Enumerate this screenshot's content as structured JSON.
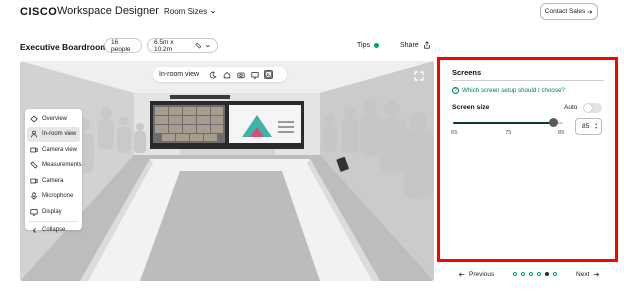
{
  "nav": {
    "logo": "CISCO",
    "app_title": "Workspace Designer",
    "room_sizes_label": "Room Sizes",
    "contact_label": "Contact Sales"
  },
  "room": {
    "name": "Executive Boardroom",
    "people": "16 people",
    "dimensions": "6.5m x 10.2m",
    "tips_label": "Tips",
    "share_label": "Share"
  },
  "viewport": {
    "toolbar_label": "In-room view",
    "toolbar_icons": [
      "moon-icon",
      "home-icon",
      "camera-icon",
      "screen-icon",
      "gallery-icon"
    ],
    "menu": [
      {
        "label": "Overview",
        "icon": "overview-icon"
      },
      {
        "label": "In-room view",
        "icon": "person-icon",
        "active": true
      },
      {
        "label": "Camera view",
        "icon": "camera-icon"
      },
      {
        "label": "Measurements",
        "icon": "ruler-icon"
      },
      {
        "label": "Camera",
        "icon": "camera-icon"
      },
      {
        "label": "Microphone",
        "icon": "microphone-icon"
      },
      {
        "label": "Display",
        "icon": "display-icon"
      },
      {
        "label": "Collapse",
        "icon": "chevron-left-icon"
      }
    ]
  },
  "panel": {
    "title": "Screens",
    "help_link": "Which screen setup should I choose?",
    "screen_size_label": "Screen size",
    "auto_label": "Auto",
    "auto_enabled": false,
    "slider_min_label": "65",
    "slider_mid_label": "75",
    "slider_max_label": "85",
    "slider_min": 65,
    "slider_max": 87,
    "slider_value": 85,
    "screen_size_value": "85"
  },
  "pager": {
    "prev_label": "Previous",
    "next_label": "Next",
    "total_steps": 6,
    "current_step": 5
  },
  "colors": {
    "accent_green": "#00a07a",
    "dark_green": "#0a3d2c",
    "highlight_red": "#ff0000"
  }
}
